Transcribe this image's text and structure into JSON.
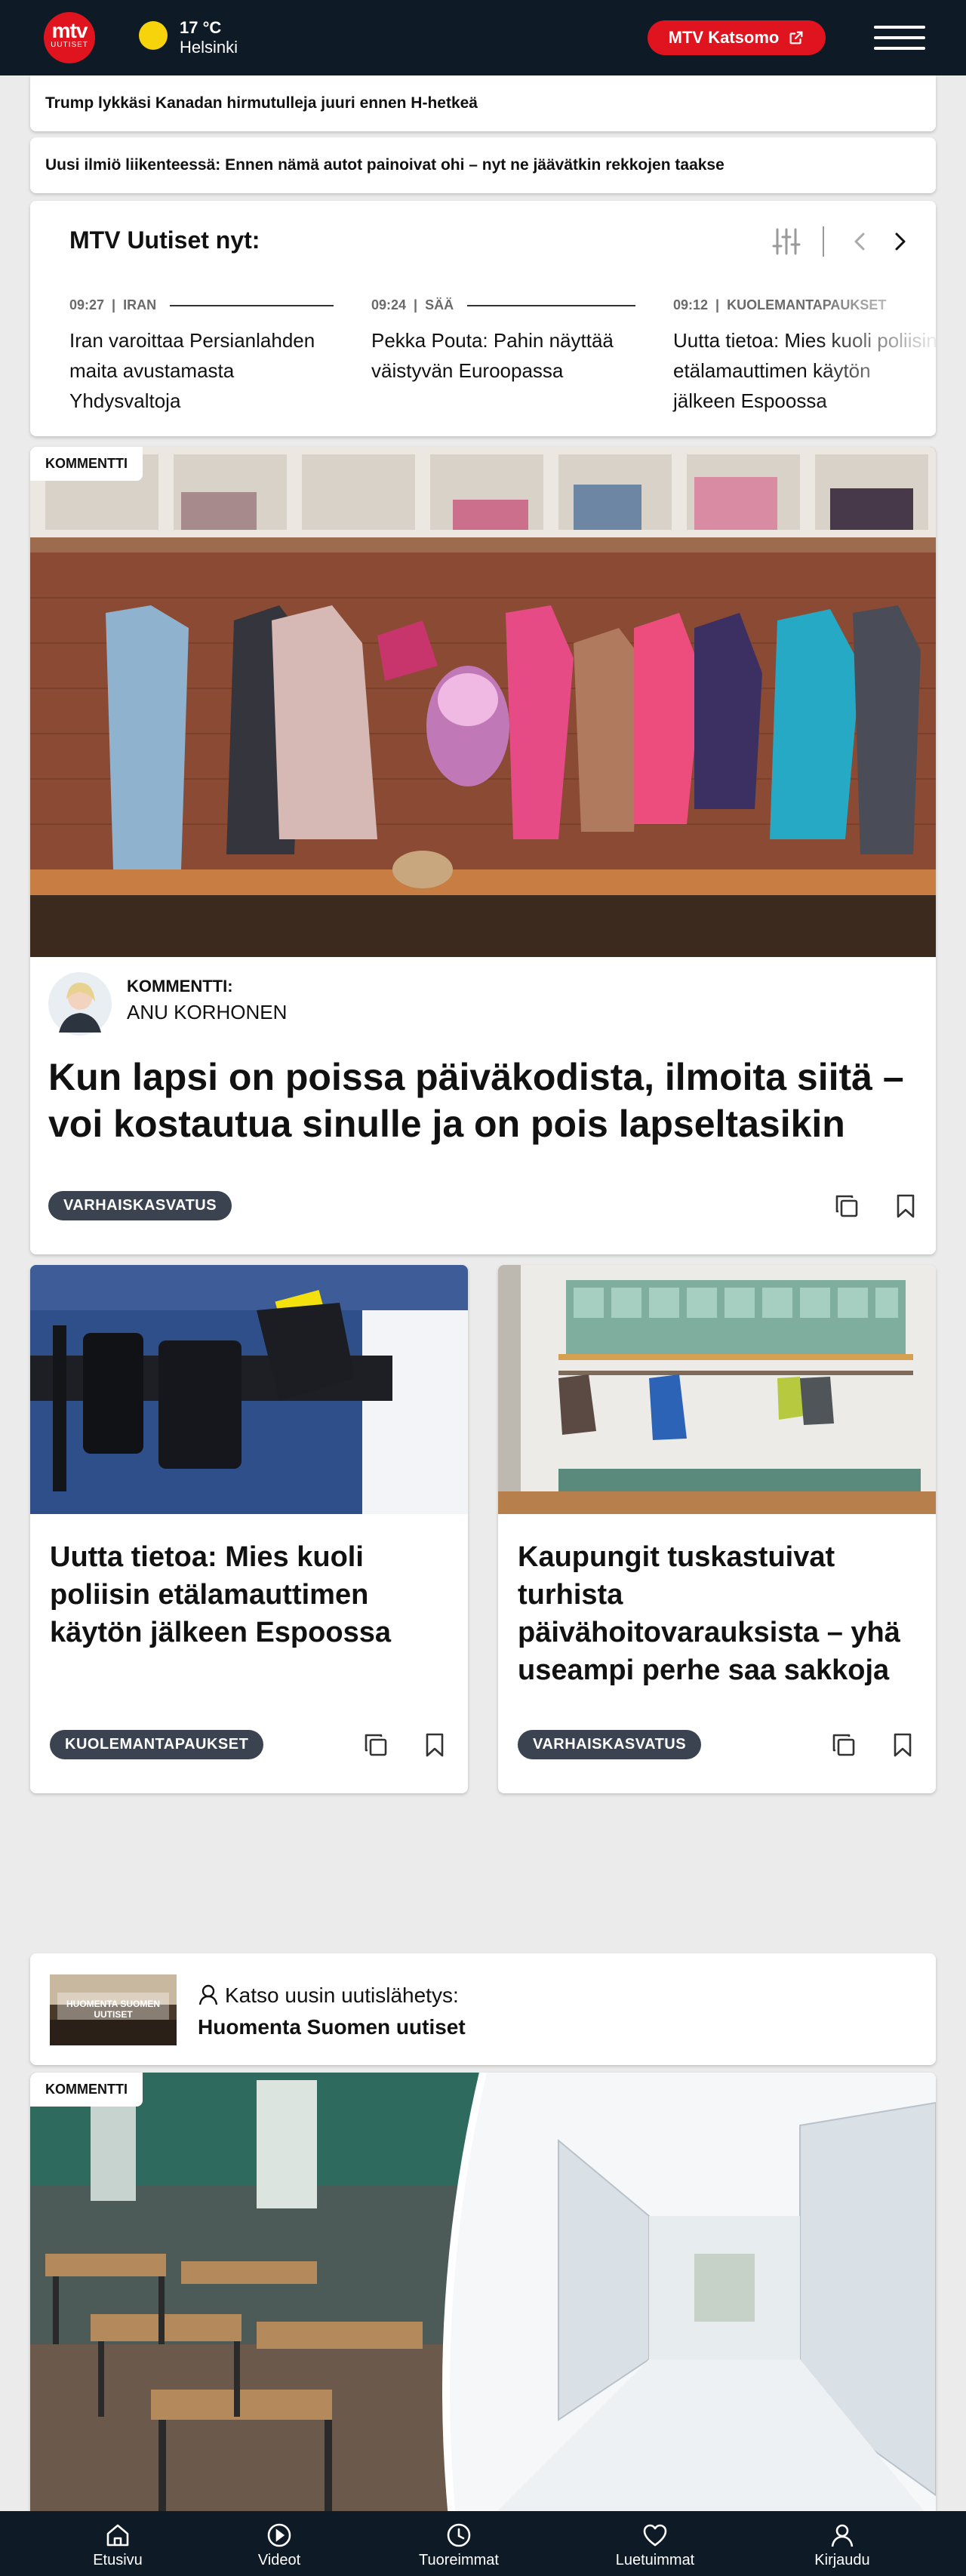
{
  "header": {
    "logo_main": "mtv",
    "logo_sub": "UUTISET",
    "weather_temp": "17 °C",
    "weather_city": "Helsinki",
    "katsomo_label": "MTV Katsomo",
    "colors": {
      "brand_red": "#e0141e",
      "header_bg": "#0e1a26",
      "sun": "#f6d30b"
    }
  },
  "tickers": [
    "Trump lykkäsi Kanadan hirmutulleja juuri ennen H-hetkeä",
    "Uusi ilmiö liikenteessä: Ennen nämä autot painoivat ohi – nyt ne jäävätkin rekkojen taakse"
  ],
  "news_now": {
    "title": "MTV Uutiset nyt:",
    "items": [
      {
        "time": "09:27",
        "category": "IRAN",
        "text": "Iran varoittaa Persianlahden maita avustamasta Yhdysvaltoja"
      },
      {
        "time": "09:24",
        "category": "SÄÄ",
        "text": "Pekka Pouta: Pahin näyttää väistyvän Euroopassa"
      },
      {
        "time": "09:12",
        "category": "KUOLEMANTAPAUKSET",
        "text": "Uutta tietoa: Mies kuoli poliisin etälamauttimen käytön jälkeen Espoossa"
      }
    ]
  },
  "featured": {
    "badge": "KOMMENTTI",
    "author_prefix": "KOMMENTTI:",
    "author_name": "ANU KORHONEN",
    "headline": "Kun lapsi on poissa päiväkodista, ilmoita siitä – voi kostautua sinulle ja on pois lapseltasikin",
    "tag": "VARHAISKASVATUS"
  },
  "small_cards": [
    {
      "headline": "Uutta tietoa: Mies kuoli poliisin etälamauttimen käytön jälkeen Espoossa",
      "tag": "KUOLEMANTAPAUKSET"
    },
    {
      "headline": "Kaupungit tuskastuivat turhista päivähoitovarauksista – yhä useampi perhe saa sakkoja",
      "tag": "VARHAISKASVATUS"
    }
  ],
  "broadcast": {
    "label": "Katso uusin uutislähetys:",
    "title": "Huomenta Suomen uutiset",
    "thumb_text": "HUOMENTA SUOMEN UUTISET"
  },
  "second_featured": {
    "badge": "KOMMENTTI"
  },
  "bottom_nav": [
    {
      "label": "Etusivu",
      "icon": "home-icon"
    },
    {
      "label": "Videot",
      "icon": "play-icon"
    },
    {
      "label": "Tuoreimmat",
      "icon": "clock-icon"
    },
    {
      "label": "Luetuimmat",
      "icon": "heart-icon"
    },
    {
      "label": "Kirjaudu",
      "icon": "user-icon"
    }
  ]
}
